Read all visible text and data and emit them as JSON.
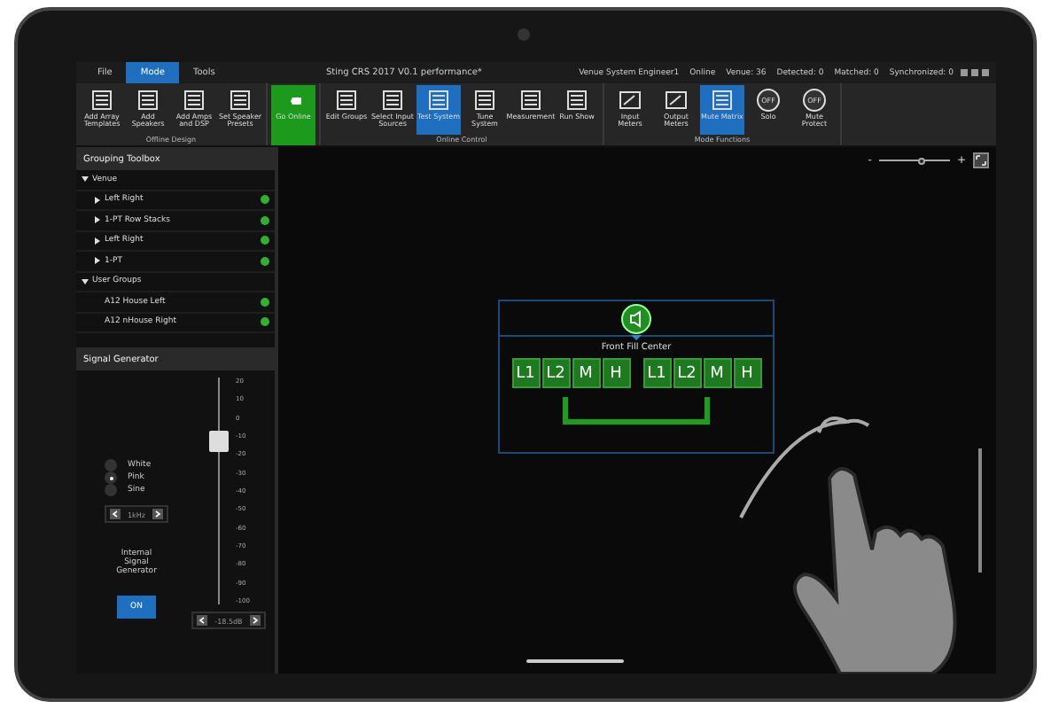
{
  "window": {
    "title": "Sting CRS 2017 V0.1 performance*"
  },
  "menu_tabs": [
    {
      "label": "File",
      "selected": false
    },
    {
      "label": "Mode",
      "selected": true
    },
    {
      "label": "Tools",
      "selected": false
    }
  ],
  "status": [
    "Venue System Engineer1",
    "Online",
    "Venue: 36",
    "Detected: 0",
    "Matched: 0",
    "Synchronized: 0"
  ],
  "ribbon_groups": [
    {
      "label": "Offline Design",
      "buttons": [
        {
          "label": "Add Array Templates",
          "kind": "normal",
          "selected": false
        },
        {
          "label": "Add Speakers",
          "kind": "normal",
          "selected": false
        },
        {
          "label": "Add Amps and DSP",
          "kind": "normal",
          "selected": false
        },
        {
          "label": "Set Speaker Presets",
          "kind": "normal",
          "selected": false
        }
      ]
    },
    {
      "buttons": [
        {
          "label": "Go Online",
          "kind": "online",
          "selected": false
        }
      ]
    },
    {
      "label": "Online Control",
      "buttons": [
        {
          "label": "Edit Groups",
          "kind": "normal",
          "selected": false
        },
        {
          "label": "Select Input Sources",
          "kind": "normal",
          "selected": false
        },
        {
          "label": "Test System",
          "kind": "normal",
          "selected": true
        },
        {
          "label": "Tune System",
          "kind": "normal",
          "selected": false
        },
        {
          "label": "Measurement",
          "kind": "normal",
          "selected": false
        },
        {
          "label": "Run Show",
          "kind": "normal",
          "selected": false
        }
      ]
    },
    {
      "label": "Mode Functions",
      "buttons": [
        {
          "label": "Input Meters",
          "kind": "meter",
          "selected": false
        },
        {
          "label": "Output Meters",
          "kind": "meter",
          "selected": false
        },
        {
          "label": "Mute Matrix",
          "kind": "normal",
          "selected": true
        },
        {
          "label": "Solo",
          "kind": "off",
          "badge": "OFF",
          "selected": false
        },
        {
          "label": "Mute Protect",
          "kind": "off",
          "badge": "OFF",
          "selected": false
        }
      ]
    }
  ],
  "grouping_toolbox": {
    "title": "Grouping Toolbox",
    "tree": [
      {
        "label": "Venue",
        "expanded": true,
        "children": [
          {
            "label": "Left Right",
            "expanded": false
          },
          {
            "label": "1-PT Row Stacks",
            "expanded": false
          },
          {
            "label": "Left Right",
            "expanded": false
          },
          {
            "label": "1-PT",
            "expanded": false
          }
        ]
      },
      {
        "label": "User Groups",
        "expanded": true,
        "children": [
          {
            "label": "A12 House Left"
          },
          {
            "label": "A12 nHouse Right"
          }
        ]
      }
    ]
  },
  "signal_generator": {
    "title": "Signal Generator",
    "options": [
      {
        "label": "White",
        "selected": false
      },
      {
        "label": "Pink",
        "selected": true
      },
      {
        "label": "Sine",
        "selected": false
      }
    ],
    "frequency": "1kHz",
    "label": "Internal Signal Generator",
    "on_button": "ON",
    "scale": [
      "20",
      "10",
      "0",
      "-10",
      "-20",
      "-30",
      "-40",
      "-50",
      "-60",
      "-70",
      "-80",
      "-90",
      "-100"
    ],
    "level": 0.72,
    "gain": "-18.5dB"
  },
  "canvas": {
    "zoom": {
      "minus": "-",
      "plus": "+",
      "level": 0.6
    },
    "group": {
      "name": "Front Fill Center",
      "amps": [
        [
          "L1",
          "L2",
          "M",
          "H"
        ],
        [
          "L1",
          "L2",
          "M",
          "H"
        ]
      ]
    }
  }
}
